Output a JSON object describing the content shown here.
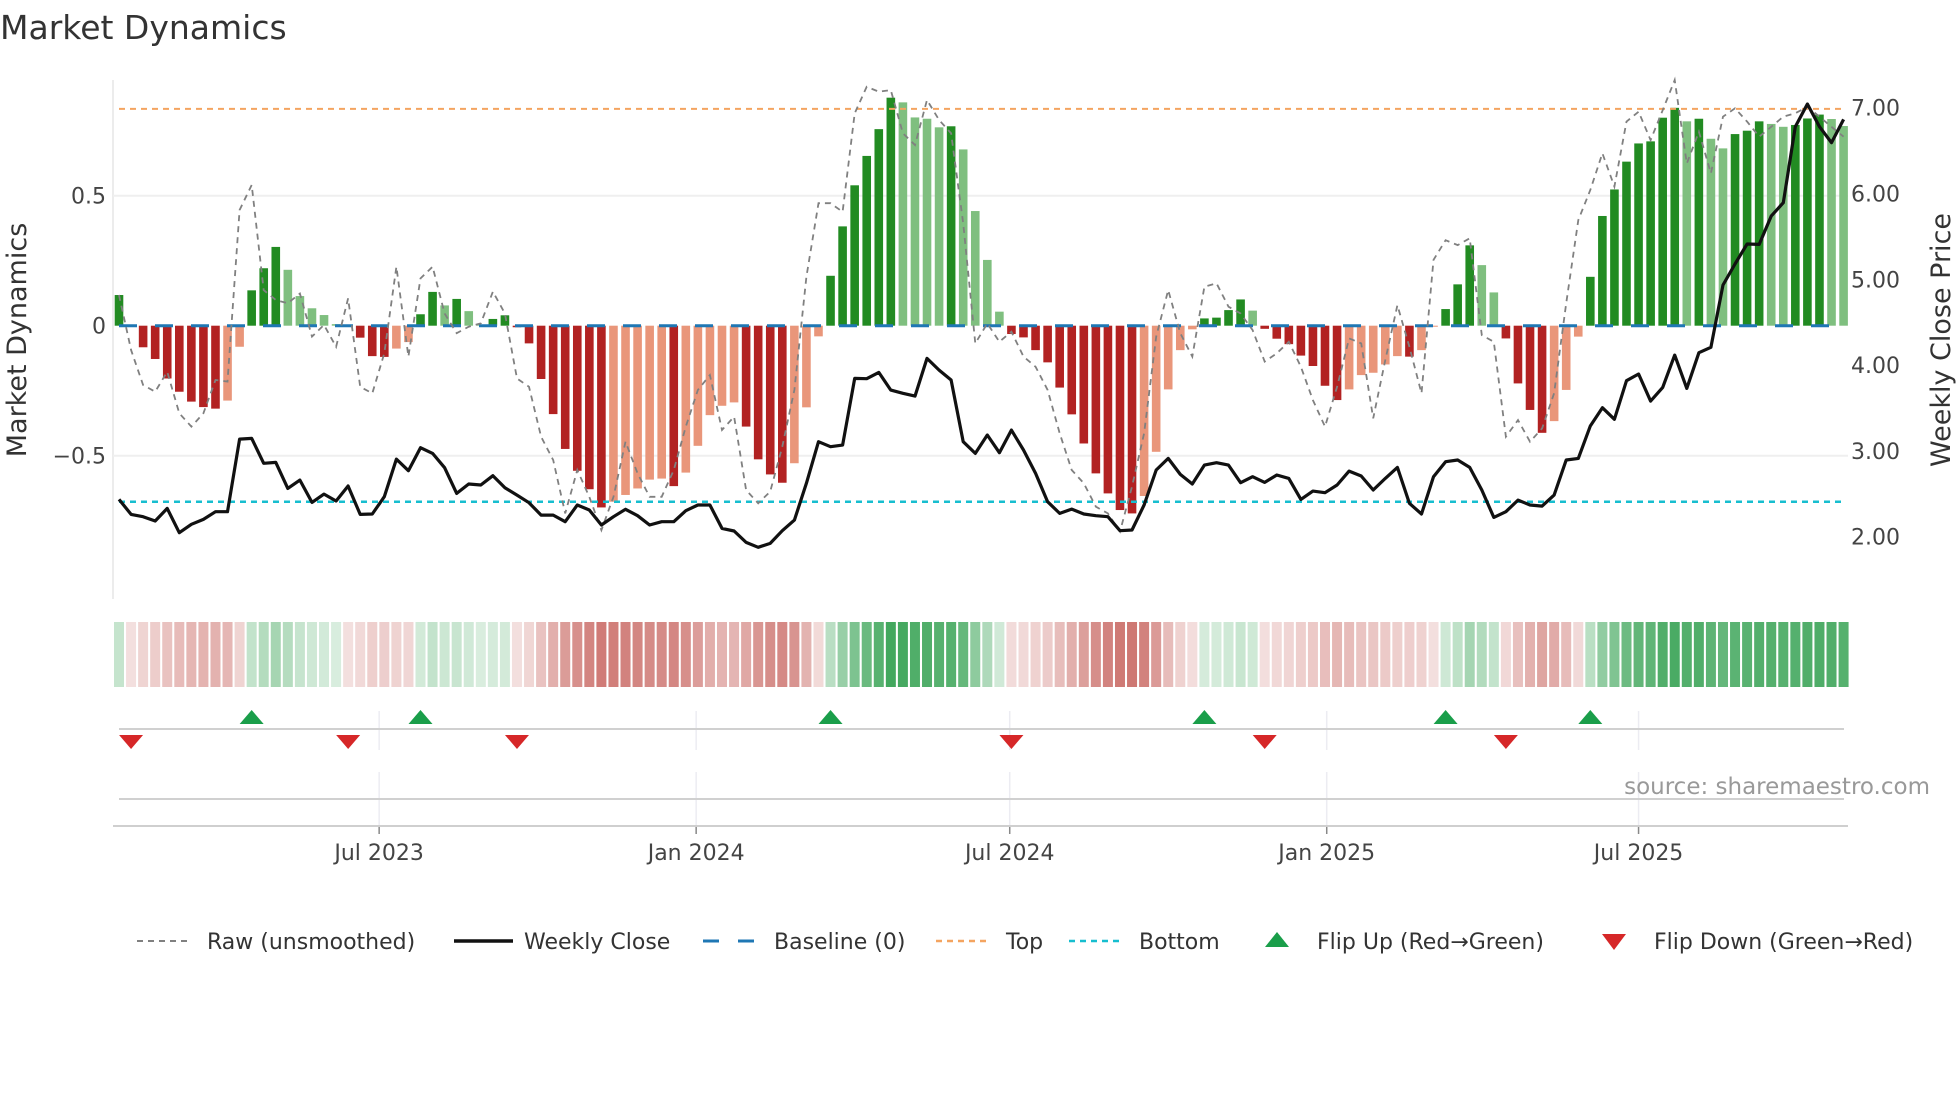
{
  "chart_data": {
    "type": "bar",
    "title": "Market Dynamics",
    "ylabel": "Market Dynamics",
    "y2label": "Weekly Close Price",
    "source": "source: sharemaestro.com",
    "first_week": "2023-01-31",
    "week_step_days": 7,
    "ylim": [
      -0.95,
      0.95
    ],
    "y2lim": [
      1.5,
      7.5
    ],
    "yticks": [
      {
        "v": 0.5,
        "label": "0.5"
      },
      {
        "v": 0,
        "label": "0"
      },
      {
        "v": -0.5,
        "label": "−0.5"
      }
    ],
    "y2ticks": [
      {
        "v": 7,
        "label": "7.00"
      },
      {
        "v": 6,
        "label": "6.00"
      },
      {
        "v": 5,
        "label": "5.00"
      },
      {
        "v": 4,
        "label": "4.00"
      },
      {
        "v": 3,
        "label": "3.00"
      },
      {
        "v": 2,
        "label": "2.00"
      }
    ],
    "xticks": [
      {
        "date": "2023-07-01",
        "label": "Jul 2023"
      },
      {
        "date": "2024-01-01",
        "label": "Jan 2024"
      },
      {
        "date": "2024-07-01",
        "label": "Jul 2024"
      },
      {
        "date": "2025-01-01",
        "label": "Jan 2025"
      },
      {
        "date": "2025-07-01",
        "label": "Jul 2025"
      }
    ],
    "top": 0.834,
    "bottom": -0.677,
    "baseline": 0,
    "colors": {
      "up_rising": "#228b22",
      "up_falling": "#7fbf7f",
      "down_falling": "#b22222",
      "down_rising": "#e9967a",
      "raw": "#808080",
      "close": "#111111",
      "baseline": "#1f77b4",
      "top": "#f4a460",
      "bottom": "#17becf",
      "flip_up": "#1a9e4a",
      "flip_down": "#d62728",
      "heat_green": "#2e9e4c",
      "heat_red": "#c0504a"
    },
    "series": [
      {
        "name": "Market Dynamics (smoothed)",
        "values": [
          0.118,
          -0.005,
          -0.083,
          -0.128,
          -0.203,
          -0.254,
          -0.292,
          -0.313,
          -0.319,
          -0.288,
          -0.081,
          0.136,
          0.221,
          0.303,
          0.215,
          0.114,
          0.067,
          0.041,
          0.006,
          -0.004,
          -0.046,
          -0.117,
          -0.12,
          -0.088,
          -0.063,
          0.044,
          0.13,
          0.078,
          0.103,
          0.056,
          0.004,
          0.026,
          0.04,
          -0.006,
          -0.068,
          -0.205,
          -0.34,
          -0.474,
          -0.558,
          -0.629,
          -0.699,
          -0.677,
          -0.651,
          -0.626,
          -0.592,
          -0.588,
          -0.617,
          -0.565,
          -0.462,
          -0.344,
          -0.308,
          -0.295,
          -0.388,
          -0.514,
          -0.572,
          -0.604,
          -0.529,
          -0.314,
          -0.041,
          0.192,
          0.382,
          0.54,
          0.653,
          0.756,
          0.877,
          0.859,
          0.801,
          0.796,
          0.763,
          0.767,
          0.678,
          0.441,
          0.253,
          0.054,
          -0.032,
          -0.045,
          -0.094,
          -0.141,
          -0.238,
          -0.341,
          -0.453,
          -0.568,
          -0.645,
          -0.709,
          -0.722,
          -0.655,
          -0.485,
          -0.245,
          -0.094,
          -0.014,
          0.028,
          0.031,
          0.06,
          0.101,
          0.058,
          -0.012,
          -0.05,
          -0.071,
          -0.115,
          -0.155,
          -0.231,
          -0.286,
          -0.245,
          -0.19,
          -0.181,
          -0.149,
          -0.117,
          -0.119,
          -0.094,
          -0.004,
          0.064,
          0.159,
          0.309,
          0.233,
          0.128,
          -0.049,
          -0.222,
          -0.324,
          -0.412,
          -0.367,
          -0.247,
          -0.042,
          0.188,
          0.422,
          0.524,
          0.631,
          0.701,
          0.709,
          0.8,
          0.838,
          0.786,
          0.796,
          0.719,
          0.682,
          0.737,
          0.75,
          0.786,
          0.776,
          0.765,
          0.772,
          0.797,
          0.812,
          0.795,
          0.768
        ]
      },
      {
        "name": "Raw (unsmoothed)",
        "values": [
          0.118,
          -0.094,
          -0.228,
          -0.254,
          -0.177,
          -0.337,
          -0.388,
          -0.337,
          -0.209,
          -0.215,
          0.445,
          0.541,
          0.137,
          0.099,
          0.086,
          0.124,
          -0.042,
          0.003,
          -0.081,
          0.105,
          -0.235,
          -0.26,
          -0.106,
          0.227,
          -0.119,
          0.182,
          0.227,
          0.047,
          -0.029,
          -0.004,
          0.009,
          0.131,
          0.047,
          -0.203,
          -0.235,
          -0.427,
          -0.517,
          -0.722,
          -0.555,
          -0.658,
          -0.786,
          -0.658,
          -0.446,
          -0.568,
          -0.658,
          -0.658,
          -0.555,
          -0.388,
          -0.247,
          -0.19,
          -0.401,
          -0.35,
          -0.632,
          -0.683,
          -0.638,
          -0.465,
          -0.247,
          0.188,
          0.471,
          0.471,
          0.438,
          0.817,
          0.919,
          0.9,
          0.906,
          0.74,
          0.695,
          0.868,
          0.791,
          0.74,
          0.394,
          -0.068,
          0.009,
          -0.062,
          -0.023,
          -0.119,
          -0.158,
          -0.247,
          -0.414,
          -0.555,
          -0.606,
          -0.696,
          -0.722,
          -0.792,
          -0.619,
          -0.414,
          -0.042,
          0.137,
          -0.029,
          -0.119,
          0.15,
          0.163,
          0.073,
          0.047,
          -0.017,
          -0.138,
          -0.106,
          -0.062,
          -0.158,
          -0.286,
          -0.388,
          -0.235,
          -0.049,
          -0.068,
          -0.356,
          -0.132,
          0.079,
          -0.081,
          -0.26,
          0.253,
          0.329,
          0.31,
          0.336,
          -0.036,
          -0.062,
          -0.427,
          -0.363,
          -0.446,
          -0.395,
          -0.26,
          0.086,
          0.406,
          0.522,
          0.663,
          0.535,
          0.785,
          0.823,
          0.714,
          0.829,
          0.945,
          0.624,
          0.746,
          0.586,
          0.804,
          0.836,
          0.785,
          0.727,
          0.765,
          0.804,
          0.817,
          0.842,
          0.804,
          0.765,
          0.727
        ]
      },
      {
        "name": "Weekly Close",
        "axis": "right",
        "values": [
          2.435,
          2.26,
          2.233,
          2.183,
          2.33,
          2.047,
          2.144,
          2.202,
          2.291,
          2.291,
          3.138,
          3.146,
          2.855,
          2.866,
          2.563,
          2.66,
          2.4,
          2.497,
          2.416,
          2.591,
          2.26,
          2.264,
          2.466,
          2.905,
          2.769,
          3.037,
          2.971,
          2.804,
          2.505,
          2.614,
          2.602,
          2.711,
          2.571,
          2.485,
          2.396,
          2.252,
          2.252,
          2.175,
          2.369,
          2.311,
          2.136,
          2.233,
          2.319,
          2.245,
          2.136,
          2.175,
          2.175,
          2.303,
          2.369,
          2.369,
          2.097,
          2.066,
          1.934,
          1.876,
          1.922,
          2.07,
          2.194,
          2.622,
          3.107,
          3.049,
          3.068,
          3.845,
          3.842,
          3.915,
          3.709,
          3.671,
          3.639,
          4.078,
          3.942,
          3.826,
          3.107,
          2.971,
          3.185,
          2.979,
          3.243,
          3.01,
          2.738,
          2.408,
          2.272,
          2.322,
          2.264,
          2.245,
          2.233,
          2.07,
          2.078,
          2.369,
          2.777,
          2.913,
          2.726,
          2.614,
          2.835,
          2.862,
          2.835,
          2.629,
          2.699,
          2.633,
          2.719,
          2.68,
          2.435,
          2.532,
          2.513,
          2.602,
          2.765,
          2.707,
          2.544,
          2.68,
          2.808,
          2.389,
          2.264,
          2.699,
          2.874,
          2.894,
          2.808,
          2.544,
          2.225,
          2.291,
          2.427,
          2.369,
          2.357,
          2.485,
          2.894,
          2.913,
          3.29,
          3.503,
          3.368,
          3.818,
          3.896,
          3.581,
          3.74,
          4.117,
          3.729,
          4.145,
          4.207,
          4.933,
          5.178,
          5.411,
          5.407,
          5.737,
          5.893,
          6.779,
          7.043,
          6.779,
          6.592,
          6.864
        ]
      }
    ],
    "legend": {
      "position": "bottom",
      "items": [
        {
          "label": "Raw (unsmoothed)",
          "kind": "raw"
        },
        {
          "label": "Weekly Close",
          "kind": "close"
        },
        {
          "label": "Baseline (0)",
          "kind": "baseline"
        },
        {
          "label": "Top",
          "kind": "top"
        },
        {
          "label": "Bottom",
          "kind": "bottom"
        },
        {
          "label": "Flip Up (Red→Green)",
          "kind": "flip_up"
        },
        {
          "label": "Flip Down (Green→Red)",
          "kind": "flip_down"
        }
      ]
    }
  }
}
